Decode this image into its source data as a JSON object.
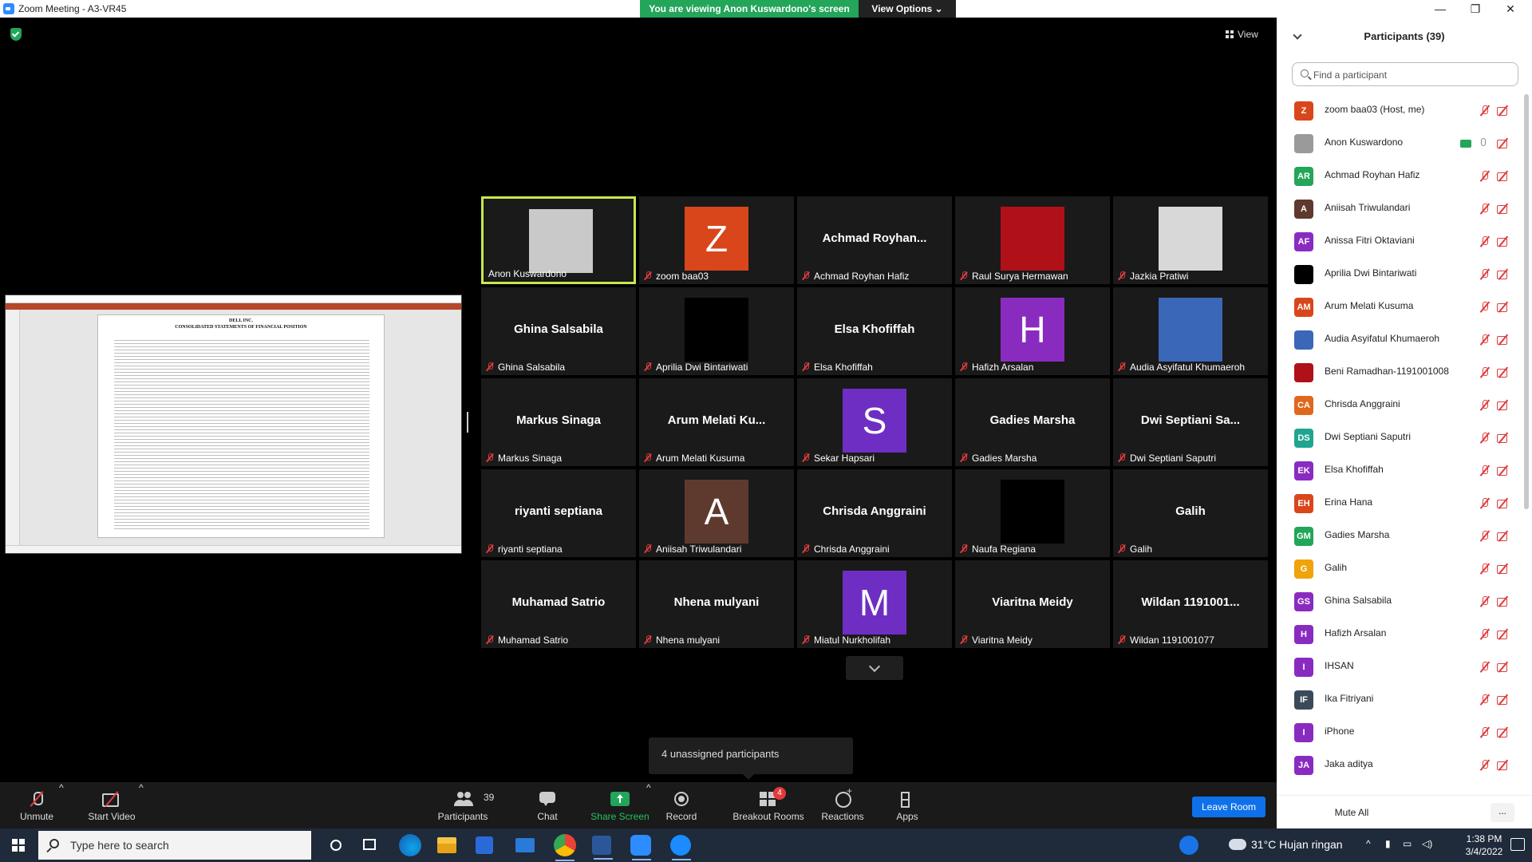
{
  "window": {
    "title": "Zoom Meeting - A3-VR45",
    "viewing_banner": "You are viewing Anon Kuswardono's screen",
    "view_options": "View Options ⌄",
    "minimize": "—",
    "restore": "❐",
    "close": "✕",
    "view_button": "View"
  },
  "shared_screen": {
    "doc_title": "DELL INC.",
    "doc_subtitle": "CONSOLIDATED STATEMENTS OF FINANCIAL POSITION"
  },
  "tiles": [
    {
      "name": "",
      "label": "Anon Kuswardono",
      "kind": "photo",
      "color": "#c9c9c9",
      "active": true,
      "muted": false
    },
    {
      "name": "",
      "label": "zoom baa03",
      "kind": "avatar",
      "letter": "Z",
      "color": "#d9461b",
      "muted": true
    },
    {
      "name": "Achmad  Royhan...",
      "label": "Achmad Royhan Hafiz",
      "kind": "text",
      "muted": true
    },
    {
      "name": "",
      "label": "Raul Surya Hermawan",
      "kind": "photo",
      "color": "#b01018",
      "muted": true
    },
    {
      "name": "",
      "label": "Jazkia Pratiwi",
      "kind": "photo",
      "color": "#d8d8d8",
      "muted": true
    },
    {
      "name": "Ghina Salsabila",
      "label": "Ghina Salsabila",
      "kind": "text",
      "muted": true
    },
    {
      "name": "",
      "label": "Aprilia Dwi Bintariwati",
      "kind": "photo",
      "color": "#000000",
      "muted": true
    },
    {
      "name": "Elsa Khofiffah",
      "label": "Elsa Khofiffah",
      "kind": "text",
      "muted": true
    },
    {
      "name": "",
      "label": "Hafizh Arsalan",
      "kind": "avatar",
      "letter": "H",
      "color": "#8a2bc0",
      "muted": true
    },
    {
      "name": "",
      "label": "Audia Asyifatul Khumaeroh",
      "kind": "photo",
      "color": "#3a67b8",
      "muted": true
    },
    {
      "name": "Markus Sinaga",
      "label": "Markus Sinaga",
      "kind": "text",
      "muted": true
    },
    {
      "name": "Arum  Melati  Ku...",
      "label": "Arum Melati Kusuma",
      "kind": "text",
      "muted": true
    },
    {
      "name": "",
      "label": "Sekar Hapsari",
      "kind": "avatar",
      "letter": "S",
      "color": "#6e2ec3",
      "muted": true
    },
    {
      "name": "Gadies Marsha",
      "label": "Gadies Marsha",
      "kind": "text",
      "muted": true
    },
    {
      "name": "Dwi  Septiani  Sa...",
      "label": "Dwi Septiani Saputri",
      "kind": "text",
      "muted": true
    },
    {
      "name": "riyanti septiana",
      "label": "riyanti septiana",
      "kind": "text",
      "muted": true
    },
    {
      "name": "",
      "label": "Aniisah Triwulandari",
      "kind": "avatar",
      "letter": "A",
      "color": "#5e3a2e",
      "muted": true
    },
    {
      "name": "Chrisda Anggraini",
      "label": "Chrisda Anggraini",
      "kind": "text",
      "muted": true
    },
    {
      "name": "",
      "label": "Naufa Regiana",
      "kind": "photo",
      "color": "#000000",
      "muted": true
    },
    {
      "name": "Galih",
      "label": "Galih",
      "kind": "text",
      "muted": true
    },
    {
      "name": "Muhamad Satrio",
      "label": "Muhamad Satrio",
      "kind": "text",
      "muted": true
    },
    {
      "name": "Nhena mulyani",
      "label": "Nhena mulyani",
      "kind": "text",
      "muted": true
    },
    {
      "name": "",
      "label": "Miatul Nurkholifah",
      "kind": "avatar",
      "letter": "M",
      "color": "#6e2ec3",
      "muted": true
    },
    {
      "name": "Viaritna Meidy",
      "label": "Viaritna Meidy",
      "kind": "text",
      "muted": true
    },
    {
      "name": "Wildan  1191001...",
      "label": "Wildan 1191001077",
      "kind": "text",
      "muted": true
    }
  ],
  "unassigned": "4 unassigned participants",
  "toolbar": {
    "unmute": "Unmute",
    "start_video": "Start Video",
    "participants": "Participants",
    "participants_count": "39",
    "chat": "Chat",
    "share_screen": "Share Screen",
    "record": "Record",
    "breakout_rooms": "Breakout Rooms",
    "breakout_badge": "4",
    "reactions": "Reactions",
    "apps": "Apps",
    "leave_room": "Leave Room",
    "caret": "^"
  },
  "panel": {
    "title": "Participants (39)",
    "search_placeholder": "Find a participant",
    "mute_all": "Mute All",
    "more": "...",
    "participants": [
      {
        "initials": "Z",
        "name": "zoom baa03 (Host, me)",
        "color": "#d9461b"
      },
      {
        "initials": "",
        "name": "Anon Kuswardono",
        "color": "#9a9a9a",
        "sharing": true
      },
      {
        "initials": "AR",
        "name": "Achmad Royhan Hafiz",
        "color": "#23a55a"
      },
      {
        "initials": "A",
        "name": "Aniisah Triwulandari",
        "color": "#5e3a2e"
      },
      {
        "initials": "AF",
        "name": "Anissa Fitri Oktaviani",
        "color": "#8a2bc0"
      },
      {
        "initials": "",
        "name": "Aprilia Dwi Bintariwati",
        "color": "#000000"
      },
      {
        "initials": "AM",
        "name": "Arum Melati Kusuma",
        "color": "#d9461b"
      },
      {
        "initials": "",
        "name": "Audia Asyifatul Khumaeroh",
        "color": "#3a67b8"
      },
      {
        "initials": "",
        "name": "Beni Ramadhan-1191001008",
        "color": "#b01018"
      },
      {
        "initials": "CA",
        "name": "Chrisda Anggraini",
        "color": "#e0681e"
      },
      {
        "initials": "DS",
        "name": "Dwi Septiani Saputri",
        "color": "#1fa58f"
      },
      {
        "initials": "EK",
        "name": "Elsa Khofiffah",
        "color": "#8a2bc0"
      },
      {
        "initials": "EH",
        "name": "Erina Hana",
        "color": "#d9461b"
      },
      {
        "initials": "GM",
        "name": "Gadies Marsha",
        "color": "#23a55a"
      },
      {
        "initials": "G",
        "name": "Galih",
        "color": "#f0a30a"
      },
      {
        "initials": "GS",
        "name": "Ghina Salsabila",
        "color": "#8a2bc0"
      },
      {
        "initials": "H",
        "name": "Hafizh Arsalan",
        "color": "#8a2bc0"
      },
      {
        "initials": "I",
        "name": "IHSAN",
        "color": "#8a2bc0"
      },
      {
        "initials": "IF",
        "name": "Ika Fitriyani",
        "color": "#3b4a5a"
      },
      {
        "initials": "I",
        "name": "iPhone",
        "color": "#8a2bc0"
      },
      {
        "initials": "JA",
        "name": "Jaka aditya",
        "color": "#8a2bc0"
      }
    ]
  },
  "taskbar": {
    "search_placeholder": "Type here to search",
    "weather": "31°C  Hujan ringan",
    "time": "1:38 PM",
    "date": "3/4/2022"
  }
}
